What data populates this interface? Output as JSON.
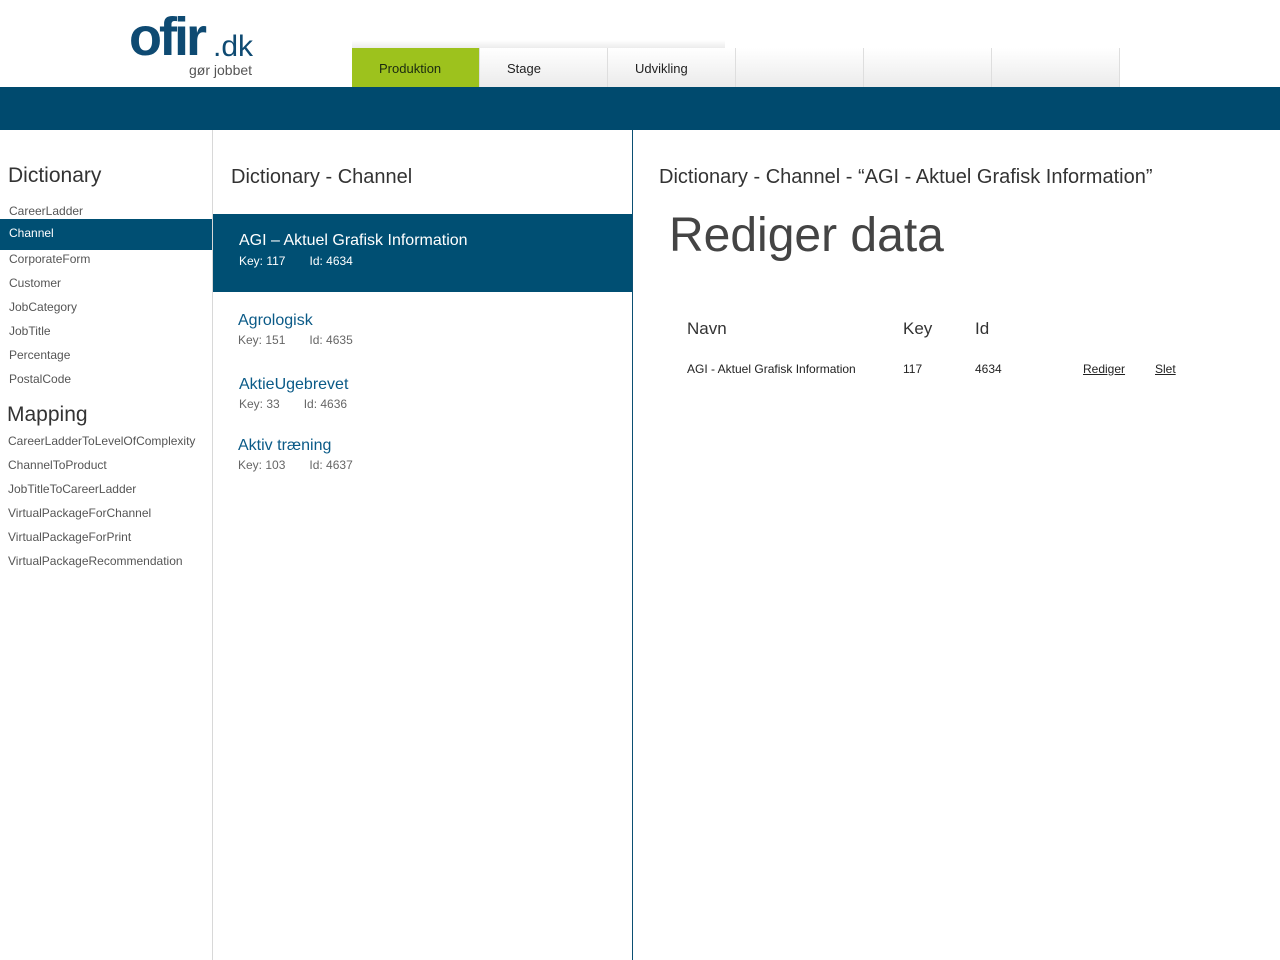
{
  "header": {
    "logo": {
      "name": "ofir",
      "tld": ".dk",
      "tagline": "gør jobbet",
      "color": "#0e4a72"
    },
    "tabs": [
      {
        "label": "Produktion",
        "active": true
      },
      {
        "label": "Stage",
        "active": false
      },
      {
        "label": "Udvikling",
        "active": false
      }
    ],
    "accent_color": "#9dc21d",
    "bar_color": "#004a6e"
  },
  "sidebar": {
    "dictionary_title": "Dictionary",
    "dictionary_items": [
      {
        "label": "CareerLadder",
        "active": false
      },
      {
        "label": "Channel",
        "active": true
      },
      {
        "label": "CorporateForm",
        "active": false
      },
      {
        "label": "Customer",
        "active": false
      },
      {
        "label": "JobCategory",
        "active": false
      },
      {
        "label": "JobTitle",
        "active": false
      },
      {
        "label": "Percentage",
        "active": false
      },
      {
        "label": "PostalCode",
        "active": false
      }
    ],
    "mapping_title": "Mapping",
    "mapping_items": [
      {
        "label": "CareerLadderToLevelOfComplexity"
      },
      {
        "label": "ChannelToProduct"
      },
      {
        "label": "JobTitleToCareerLadder"
      },
      {
        "label": "VirtualPackageForChannel"
      },
      {
        "label": "VirtualPackageForPrint"
      },
      {
        "label": "VirtualPackageRecommendation"
      }
    ]
  },
  "middle": {
    "title": "Dictionary - Channel",
    "items": [
      {
        "name": "AGI – Aktuel Grafisk Information",
        "key": "Key: 117",
        "id": "Id: 4634",
        "active": true
      },
      {
        "name": "Agrologisk",
        "key": "Key: 151",
        "id": "Id: 4635",
        "active": false
      },
      {
        "name": "AktieUgebrevet",
        "key": "Key: 33",
        "id": "Id: 4636",
        "active": false
      },
      {
        "name": "Aktiv træning",
        "key": "Key: 103",
        "id": "Id: 4637",
        "active": false
      }
    ]
  },
  "detail": {
    "title": "Dictionary - Channel - “AGI - Aktuel Grafisk Information”",
    "heading": "Rediger data",
    "table": {
      "headers": [
        "Navn",
        "Key",
        "Id"
      ],
      "row": {
        "navn": "AGI - Aktuel Grafisk Information",
        "key": "117",
        "id": "4634",
        "edit_label": "Rediger",
        "delete_label": "Slet"
      }
    }
  }
}
